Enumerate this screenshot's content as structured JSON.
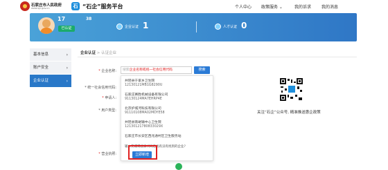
{
  "header": {
    "gov_name": "石家庄市人民政府",
    "gov_sub": "www.sjz.gov.cn",
    "app_logo_glyph": "石",
    "app_title": "“石企”服务平台",
    "nav": [
      "个人中心",
      "政策服务 ⌄",
      "我的诉求",
      "我的消息"
    ]
  },
  "banner": {
    "user_name": "17",
    "user_num": "38",
    "verified_badge": "已认证",
    "stats": [
      {
        "label": "企业认证",
        "value": "1"
      },
      {
        "label": "人才认证",
        "value": "0"
      }
    ]
  },
  "sidebar": {
    "items": [
      {
        "label": "基本信息",
        "active": false
      },
      {
        "label": "账户安全",
        "active": false
      },
      {
        "label": "企业认证",
        "active": true
      }
    ],
    "chevron": "›"
  },
  "breadcrumb": {
    "root": "企业认证",
    "sep": " > ",
    "current": "认证企业"
  },
  "form": {
    "labels": {
      "company_name": "企业名称:",
      "credit_code": "* 统一社会信用代码:",
      "applicant": "申请人:",
      "user_type": "* 用户类型:",
      "attachment": "营业执照:"
    },
    "search": {
      "placeholder_prefix": "搜索",
      "placeholder_highlight": "企业名称或统一社会信用代码",
      "button": "搜索"
    }
  },
  "dropdown": {
    "results": [
      {
        "name": "井陉县于家乡卫生院",
        "code": "12130121MB1G8290U"
      },
      {
        "name": "石家庄赛胜机械设备有限公司",
        "code": "91130124MA7EHRP4E"
      },
      {
        "name": "北京护城河科技有限公司",
        "code": "91110108MA02MDYE58"
      },
      {
        "name": "井陉县南峪镇中心卫生院",
        "code": "12130121780833029X"
      },
      {
        "name": "石家庄市长安区西兆通村区卫生服务站",
        "code": ""
      }
    ],
    "question": "输入完成或搜索代码后找有没有找到的企业?",
    "register_button": "立即新增"
  },
  "qr_caption": "关注“石企”公众号, 精准推送惠企政策",
  "colors": {
    "primary": "#2b7bd6",
    "banner_start": "#4aa2d8",
    "banner_end": "#2f77c6",
    "highlight": "#e02020",
    "verified": "#1bab6a"
  }
}
